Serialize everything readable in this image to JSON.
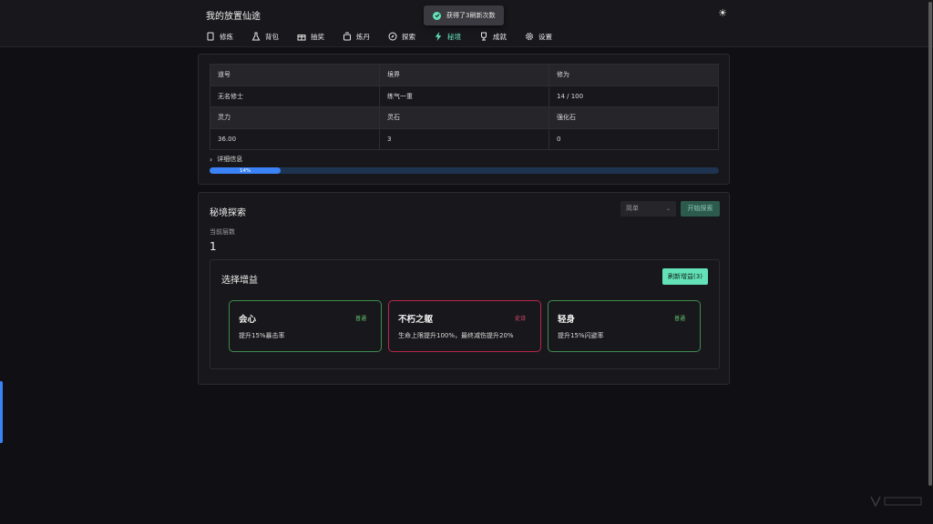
{
  "app": {
    "title": "我的放置仙途"
  },
  "toast": {
    "text": "获得了3刷新次数"
  },
  "nav": {
    "items": [
      {
        "label": "修炼",
        "icon": "book-icon"
      },
      {
        "label": "背包",
        "icon": "flask-icon"
      },
      {
        "label": "抽奖",
        "icon": "gift-icon"
      },
      {
        "label": "炼丹",
        "icon": "cauldron-icon"
      },
      {
        "label": "探索",
        "icon": "compass-icon"
      },
      {
        "label": "秘境",
        "icon": "lightning-icon",
        "active": true
      },
      {
        "label": "成就",
        "icon": "trophy-icon"
      },
      {
        "label": "设置",
        "icon": "gear-icon"
      }
    ]
  },
  "stats": {
    "headers1": [
      "道号",
      "境界",
      "修为"
    ],
    "values1": [
      "无名修士",
      "练气一重",
      "14 / 100"
    ],
    "headers2": [
      "灵力",
      "灵石",
      "强化石"
    ],
    "values2": [
      "36.00",
      "3",
      "0"
    ],
    "details_label": "详细信息",
    "progress_label": "14%",
    "progress_value": 0.14
  },
  "explore": {
    "title": "秘境探索",
    "difficulty": "简单",
    "start_label": "开始探索",
    "floor_label": "当前层数",
    "floor_value": "1",
    "buff_title": "选择增益",
    "refresh_label": "刷新增益(3)",
    "buffs": [
      {
        "name": "会心",
        "rarity": "普通",
        "desc": "提升15%暴击率",
        "tier": "common"
      },
      {
        "name": "不朽之躯",
        "rarity": "史诗",
        "desc": "生命上限提升100%，最终减伤提升20%",
        "tier": "epic"
      },
      {
        "name": "轻身",
        "rarity": "普通",
        "desc": "提升15%闪避率",
        "tier": "common"
      }
    ]
  },
  "colors": {
    "accent": "#63e2b7",
    "progress": "#3b82f6",
    "epic": "#b8264a",
    "common": "#3f8c4e"
  }
}
